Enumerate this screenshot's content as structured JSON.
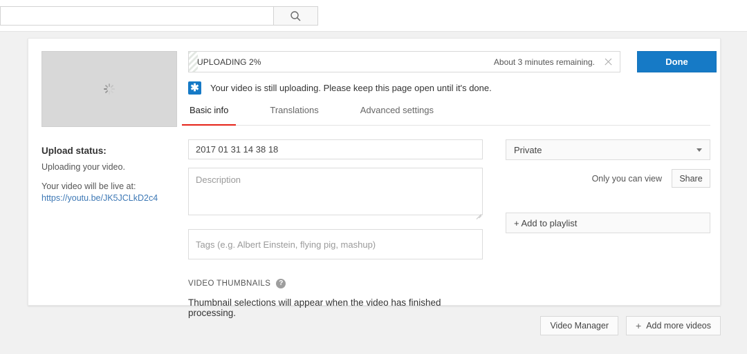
{
  "search": {
    "value": "",
    "placeholder": "",
    "icon": "search-icon"
  },
  "upload": {
    "progress_label": "UPLOADING 2%",
    "progress_percent": 2,
    "time_remaining": "About 3 minutes remaining.",
    "close_icon": "close-icon",
    "done_label": "Done",
    "notice_icon": "asterisk-icon",
    "notice_text": "Your video is still uploading. Please keep this page open until it's done.",
    "accent_blue": "#167ac6"
  },
  "status": {
    "thumbnail_spinner": "loading-spinner-icon",
    "title": "Upload status:",
    "text": "Uploading your video.",
    "live_at_label": "Your video will be live at:",
    "live_url": "https://youtu.be/JK5JCLkD2c4",
    "link_color": "#3d78b5"
  },
  "tabs": [
    {
      "label": "Basic info",
      "active": true
    },
    {
      "label": "Translations",
      "active": false
    },
    {
      "label": "Advanced settings",
      "active": false
    }
  ],
  "tab_accent": "#e52117",
  "form": {
    "title_value": "2017 01 31 14 38 18",
    "title_placeholder": "Title",
    "description_value": "",
    "description_placeholder": "Description",
    "tags_value": "",
    "tags_placeholder": "Tags (e.g. Albert Einstein, flying pig, mashup)"
  },
  "privacy": {
    "selected": "Private",
    "caret_icon": "chevron-down-icon",
    "visibility_note": "Only you can view",
    "share_label": "Share",
    "playlist_label": "+ Add to playlist"
  },
  "thumbnails": {
    "heading": "VIDEO THUMBNAILS",
    "help_icon": "help-icon",
    "help_glyph": "?",
    "message": "Thumbnail selections will appear when the video has finished processing."
  },
  "footer": {
    "video_manager_label": "Video Manager",
    "add_more_label": "Add more videos",
    "add_more_plus": "+"
  }
}
